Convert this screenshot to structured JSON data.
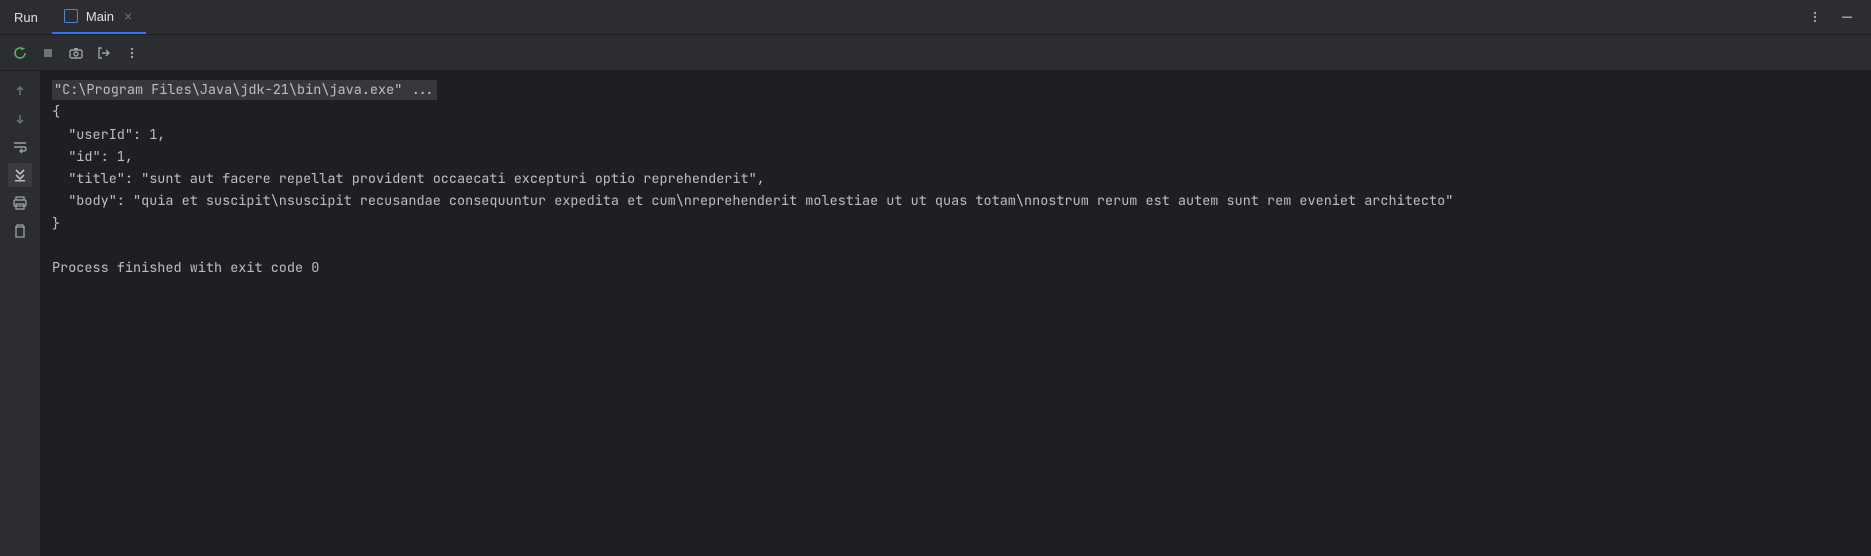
{
  "header": {
    "title": "Run",
    "tab": {
      "label": "Main"
    }
  },
  "console": {
    "command": "\"C:\\Program Files\\Java\\jdk-21\\bin\\java.exe\" ...",
    "line1": "{",
    "line2": "  \"userId\": 1,",
    "line3": "  \"id\": 1,",
    "line4": "  \"title\": \"sunt aut facere repellat provident occaecati excepturi optio reprehenderit\",",
    "line5": "  \"body\": \"quia et suscipit\\nsuscipit recusandae consequuntur expedita et cum\\nreprehenderit molestiae ut ut quas totam\\nnostrum rerum est autem sunt rem eveniet architecto\"",
    "line6": "}",
    "exit": "Process finished with exit code 0"
  }
}
